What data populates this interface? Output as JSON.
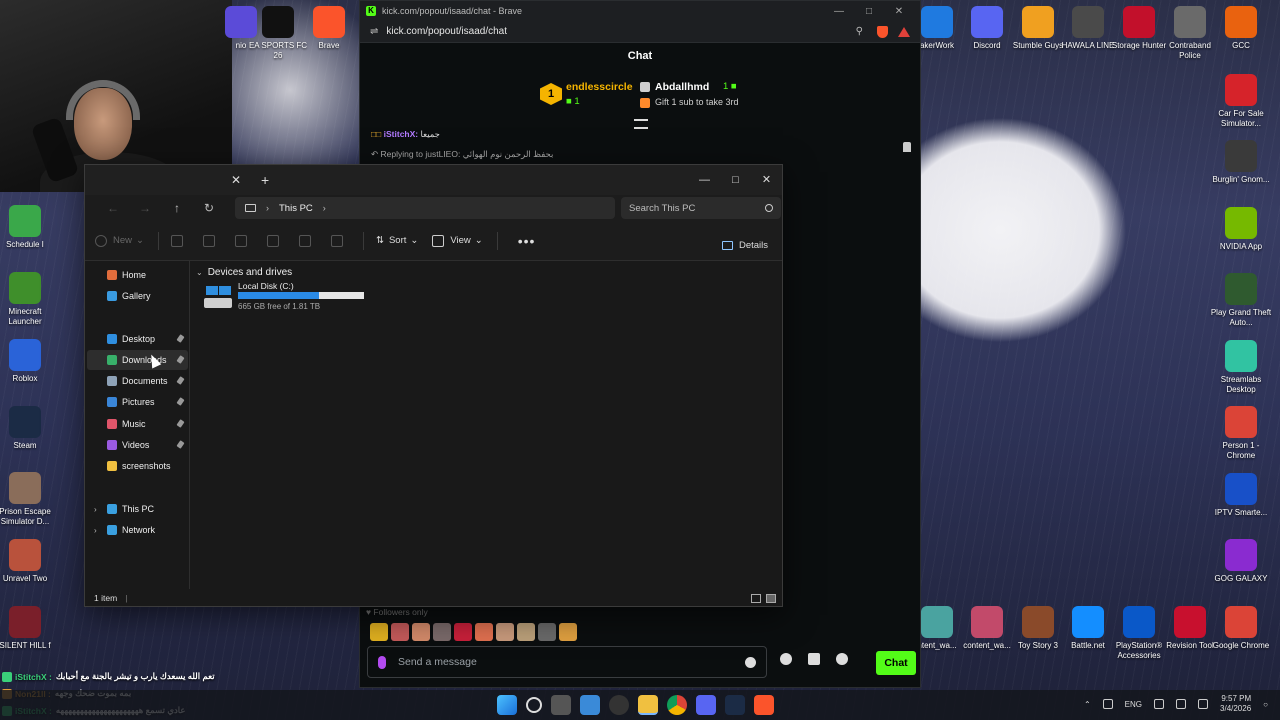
{
  "desktop": {
    "left_icons": [
      {
        "label": "Schedule I",
        "icon": "schedule-icon",
        "color": "#3aa84a"
      },
      {
        "label": "Minecraft Launcher",
        "icon": "minecraft-icon",
        "color": "#3f8f2b"
      },
      {
        "label": "Roblox",
        "icon": "roblox-icon",
        "color": "#2a63d8"
      },
      {
        "label": "Steam",
        "icon": "steam-icon",
        "color": "#1b2b45"
      },
      {
        "label": "Prison Escape Simulator D...",
        "icon": "prison-escape-icon",
        "color": "#8a6d5a"
      },
      {
        "label": "Unravel Two",
        "icon": "unravel-icon",
        "color": "#b9523c"
      },
      {
        "label": "SILENT HILL f",
        "icon": "silent-hill-icon",
        "color": "#7a1f2a"
      }
    ],
    "top_icons": [
      {
        "label": "nio",
        "icon": "app-icon",
        "color": "#5b4bd8"
      },
      {
        "label": "EA SPORTS FC 26",
        "icon": "ea-fc-icon",
        "color": "#111111"
      },
      {
        "label": "Brave",
        "icon": "brave-icon",
        "color": "#fb542b"
      }
    ],
    "right_icons_row": [
      {
        "label": "akerWork",
        "icon": "makerwork-icon",
        "color": "#1f7ae0"
      },
      {
        "label": "Discord",
        "icon": "discord-icon",
        "color": "#5865f2"
      },
      {
        "label": "Stumble Guys",
        "icon": "stumble-guys-icon",
        "color": "#f0a020"
      },
      {
        "label": "HAWALA LINE",
        "icon": "hawala-icon",
        "color": "#4a4a4a"
      },
      {
        "label": "Storage Hunter",
        "icon": "storage-hunter-icon",
        "color": "#c2102b"
      },
      {
        "label": "Contraband Police",
        "icon": "contraband-icon",
        "color": "#6a6a6a"
      },
      {
        "label": "GCC",
        "icon": "gcc-icon",
        "color": "#e9620f"
      }
    ],
    "right_column": [
      {
        "label": "Car For Sale Simulator...",
        "icon": "car-for-sale-icon",
        "color": "#d6232a"
      },
      {
        "label": "Burglin' Gnom...",
        "icon": "gnome-icon",
        "color": "#3a3a3a"
      },
      {
        "label": "NVIDIA App",
        "icon": "nvidia-icon",
        "color": "#76b900"
      },
      {
        "label": "Play Grand Theft Auto...",
        "icon": "gta-icon",
        "color": "#2f5a2f"
      },
      {
        "label": "Streamlabs Desktop",
        "icon": "streamlabs-icon",
        "color": "#31c3a2"
      },
      {
        "label": "Person 1 - Chrome",
        "icon": "chrome-icon",
        "color": "#db4437"
      },
      {
        "label": "IPTV Smarte...",
        "icon": "iptv-icon",
        "color": "#1850c8"
      },
      {
        "label": "GOG GALAXY",
        "icon": "gog-icon",
        "color": "#8a2bd0"
      },
      {
        "label": "Google Chrome",
        "icon": "chrome-icon",
        "color": "#db4437"
      }
    ],
    "bottom_right_icons": [
      {
        "label": "ntent_wa...",
        "icon": "file-icon",
        "color": "#4aa3a0"
      },
      {
        "label": "content_wa...",
        "icon": "file-icon",
        "color": "#c24a6a"
      },
      {
        "label": "Toy Story 3",
        "icon": "toy-story-icon",
        "color": "#8a4a2a"
      },
      {
        "label": "Battle.net",
        "icon": "battlenet-icon",
        "color": "#148eff"
      },
      {
        "label": "PlayStation® Accessories",
        "icon": "playstation-icon",
        "color": "#0a58c8"
      },
      {
        "label": "Revision Tool",
        "icon": "revision-icon",
        "color": "#c8102e"
      }
    ]
  },
  "kick": {
    "window_title": "kick.com/popout/isaad/chat - Brave",
    "url": "kick.com/popout/isaad/chat",
    "header": "Chat",
    "leader1": {
      "rank": "1",
      "name": "endlesscircle",
      "count": "1"
    },
    "leader2": {
      "name": "Abdallhmd",
      "count": "1"
    },
    "gift_text": "Gift 1 sub to take 3rd",
    "msg1_user": "iStitchX:",
    "msg1_text": "جميعا",
    "msg2_text": "Replying to justLIEO: بحفظ الرحمن نوم الهوائي",
    "followers_only": "Followers only",
    "input_placeholder": "Send a message",
    "send_label": "Chat"
  },
  "explorer": {
    "nav_location": "This PC",
    "search_placeholder": "Search This PC",
    "toolbar": {
      "new": "New",
      "sort": "Sort",
      "view": "View",
      "details": "Details"
    },
    "sidebar": [
      {
        "label": "Home",
        "icon": "home-icon",
        "color": "#e06c3c",
        "pinned": false
      },
      {
        "label": "Gallery",
        "icon": "gallery-icon",
        "color": "#3a9be0",
        "pinned": false
      },
      {
        "label": "Desktop",
        "icon": "desktop-icon",
        "color": "#2f8fe0",
        "pinned": true
      },
      {
        "label": "Downloads",
        "icon": "downloads-icon",
        "color": "#38b06a",
        "pinned": true
      },
      {
        "label": "Documents",
        "icon": "documents-icon",
        "color": "#8fa3b8",
        "pinned": true
      },
      {
        "label": "Pictures",
        "icon": "pictures-icon",
        "color": "#3a86d8",
        "pinned": true
      },
      {
        "label": "Music",
        "icon": "music-icon",
        "color": "#e0556a",
        "pinned": true
      },
      {
        "label": "Videos",
        "icon": "videos-icon",
        "color": "#9a5ae0",
        "pinned": true
      },
      {
        "label": "screenshots",
        "icon": "folder-icon",
        "color": "#f0c040",
        "pinned": false
      },
      {
        "label": "This PC",
        "icon": "pc-icon",
        "color": "#3aa0e0",
        "pinned": false
      },
      {
        "label": "Network",
        "icon": "network-icon",
        "color": "#3aa0e0",
        "pinned": false
      }
    ],
    "section": "Devices and drives",
    "drive": {
      "name": "Local Disk (C:)",
      "free": "665 GB free of 1.81 TB",
      "used_fraction": 0.64
    },
    "status": "1 item"
  },
  "overlay_chat": [
    {
      "user": "iStitchX :",
      "text": "تعم الله يسعدك يارب و تيشر بالجنة مع أحبابك",
      "badge": "#3ad07a"
    },
    {
      "user": "Non21ll :",
      "text": "بمه بموت ضحك وجهه",
      "badge": "#e09a3a"
    },
    {
      "user": "iStitchX :",
      "text": "عادي تسمع هههههههههههههههههههههه",
      "badge": "#3ad07a"
    }
  ],
  "taskbar": {
    "lang": "ENG",
    "time": "9:57 PM",
    "date": "3/4/2026"
  }
}
